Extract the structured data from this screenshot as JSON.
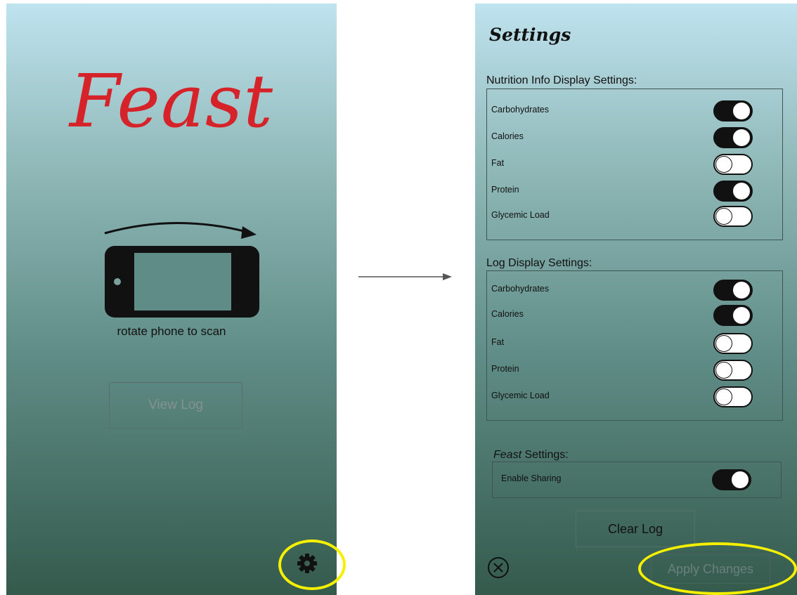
{
  "left_screen": {
    "logo": "Feast",
    "rotate_caption": "rotate phone to scan",
    "view_log_label": "View Log",
    "settings_icon": "gear-icon"
  },
  "settings": {
    "title": "Settings",
    "nutrition": {
      "title": "Nutrition Info Display Settings:",
      "items": [
        {
          "label": "Carbohydrates",
          "on": true
        },
        {
          "label": "Calories",
          "on": true
        },
        {
          "label": "Fat",
          "on": false
        },
        {
          "label": "Protein",
          "on": true
        },
        {
          "label": "Glycemic Load",
          "on": false
        }
      ]
    },
    "log": {
      "title": "Log Display Settings:",
      "items": [
        {
          "label": "Carbohydrates",
          "on": true
        },
        {
          "label": "Calories",
          "on": true
        },
        {
          "label": "Fat",
          "on": false
        },
        {
          "label": "Protein",
          "on": false
        },
        {
          "label": "Glycemic Load",
          "on": false
        }
      ]
    },
    "feast": {
      "title_italic": "Feast",
      "title_rest": " Settings:",
      "items": [
        {
          "label": "Enable Sharing",
          "on": true
        }
      ]
    },
    "clear_log_label": "Clear Log",
    "apply_label": "Apply Changes",
    "close_icon": "close-circle-icon"
  },
  "colors": {
    "logo_red": "#d6232a",
    "highlight_yellow": "#f5f000",
    "gradient_top": "#bfe3ef",
    "gradient_bottom": "#345a4c"
  }
}
